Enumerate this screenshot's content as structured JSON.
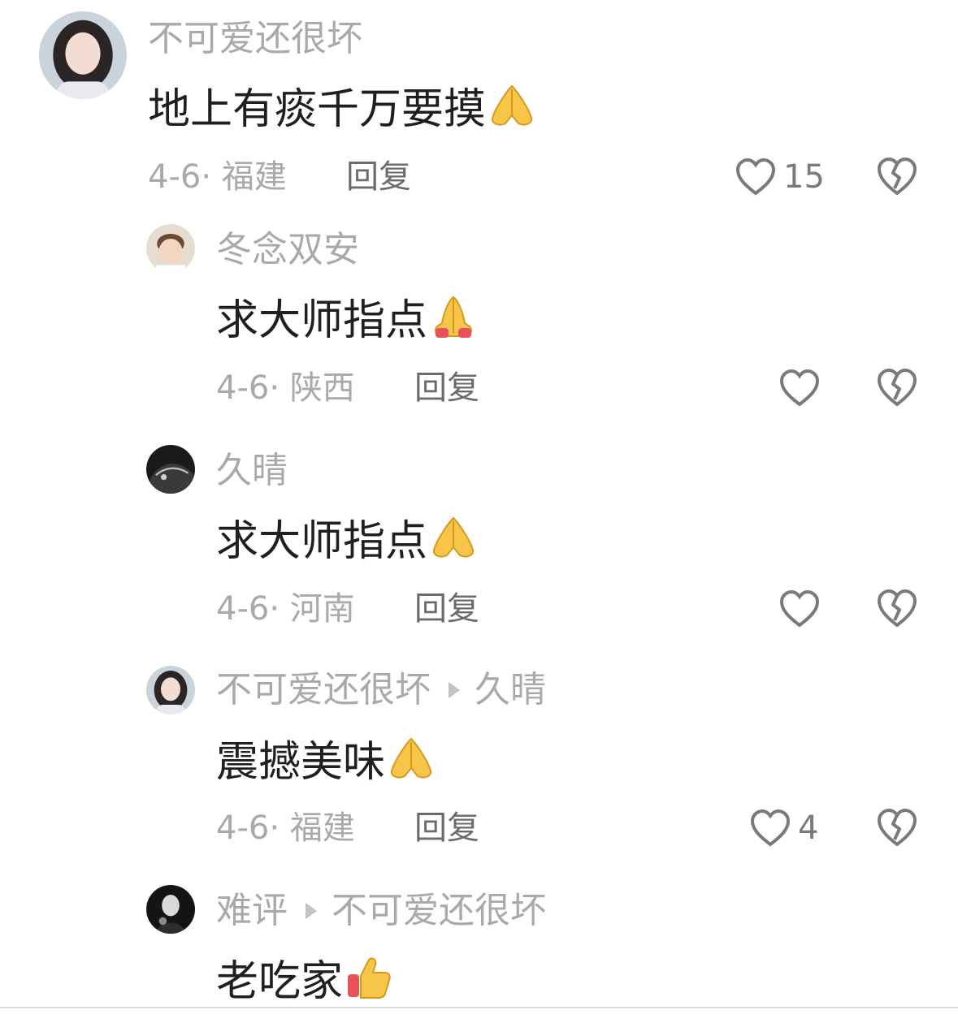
{
  "comments": [
    {
      "user": "不可爱还很坏",
      "reply_to": "",
      "text": "地上有痰千万要摸",
      "emoji": "folded-hands-icon",
      "date": "4-6",
      "location": "福建",
      "reply_label": "回复",
      "likes": "15"
    },
    {
      "user": "冬念双安",
      "reply_to": "",
      "text": "求大师指点",
      "emoji": "folded-hands-icon",
      "date": "4-6",
      "location": "陕西",
      "reply_label": "回复",
      "likes": ""
    },
    {
      "user": "久晴",
      "reply_to": "",
      "text": "求大师指点",
      "emoji": "folded-hands-icon",
      "date": "4-6",
      "location": "河南",
      "reply_label": "回复",
      "likes": ""
    },
    {
      "user": "不可爱还很坏",
      "reply_to": "久晴",
      "text": "震撼美味",
      "emoji": "folded-hands-icon",
      "date": "4-6",
      "location": "福建",
      "reply_label": "回复",
      "likes": "4"
    },
    {
      "user": "难评",
      "reply_to": "不可爱还很坏",
      "text": "老吃家",
      "emoji": "thumbs-up-icon",
      "date": "",
      "location": "",
      "reply_label": "",
      "likes": ""
    }
  ],
  "colors": {
    "text": "#1f1f1f",
    "muted": "#a9a9a9",
    "reply": "#6b6b6b",
    "icon": "#7a7a7a"
  }
}
